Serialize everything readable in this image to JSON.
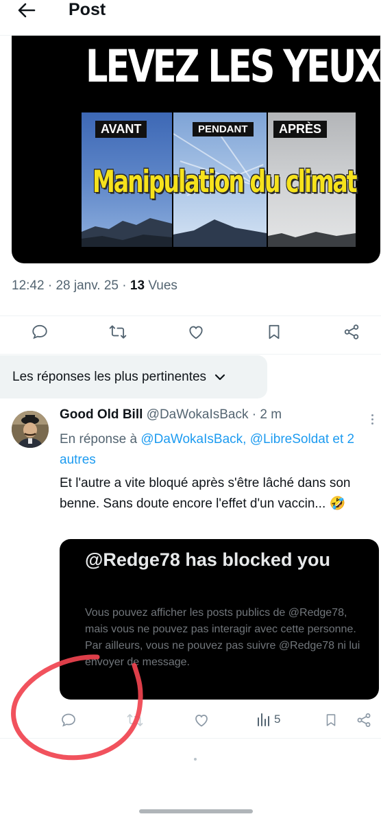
{
  "header": {
    "title": "Post"
  },
  "media": {
    "title": "LEVEZ LES YEUX !",
    "panels": [
      "AVANT",
      "PENDANT",
      "APRÈS"
    ],
    "subtitle": "Manipulation du climat"
  },
  "post_meta": {
    "time": "12:42",
    "date": "28 janv. 25",
    "views_count": "13",
    "views_label": "Vues"
  },
  "sort": {
    "label": "Les réponses les plus pertinentes"
  },
  "reply": {
    "name": "Good Old Bill",
    "handle": "@DaWokaIsBack",
    "time": "2 m",
    "reply_prefix": "En réponse à",
    "reply_handle_1": "@DaWokaIsBack,",
    "reply_handle_2": "@LibreSoldat",
    "reply_others": "et 2 autres",
    "text": "Et l'autre a vite bloqué après s'être lâché dans son benne. Sans doute encore l'effet d'un vaccin... 🤣",
    "quote_title": "@Redge78 has blocked you",
    "quote_body": "Vous pouvez afficher les posts publics de @Redge78, mais vous ne pouvez pas interagir avec cette personne. Par ailleurs, vous ne pouvez pas suivre @Redge78 ni lui envoyer de message.",
    "views": "5"
  },
  "colors": {
    "link": "#1d9bf0",
    "secondary_text": "#536471",
    "annotation_red": "#f0434f",
    "subtitle_yellow": "#f6e21c"
  },
  "icons": [
    "back-arrow-icon",
    "reply-icon",
    "repost-icon",
    "like-icon",
    "bookmark-icon",
    "share-icon",
    "chevron-down-icon",
    "more-icon",
    "views-icon"
  ]
}
